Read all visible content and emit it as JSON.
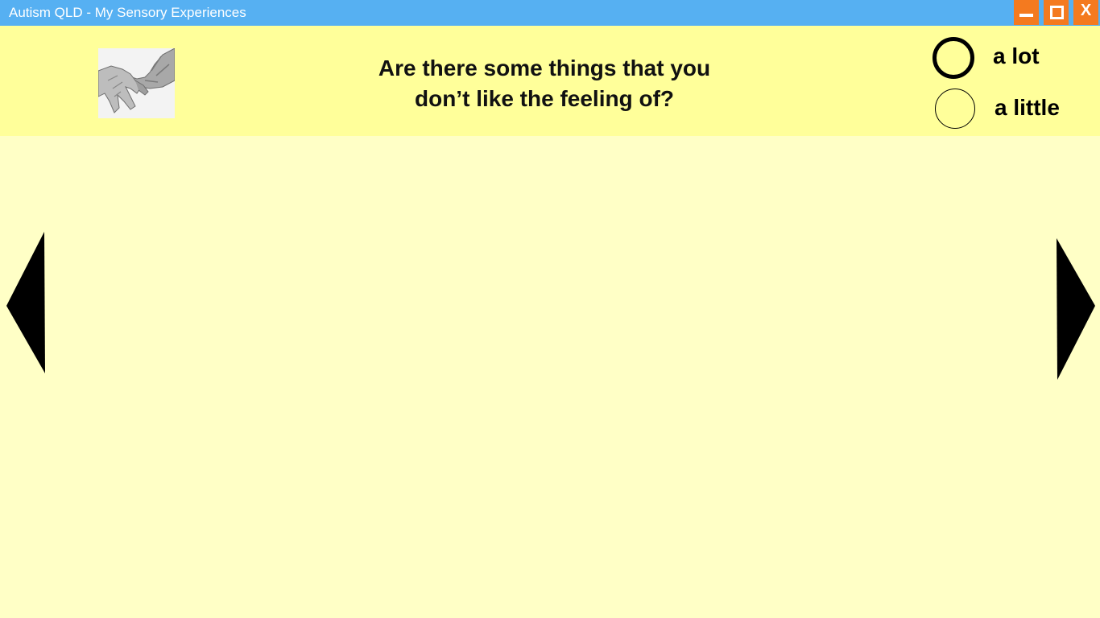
{
  "window": {
    "title": "Autism QLD - My Sensory Experiences",
    "controls": {
      "close_label": "X"
    },
    "titlebar_color": "#56b0f2",
    "button_color": "#f47a1f"
  },
  "header": {
    "background_color": "#ffff9a",
    "question_line1": "Are there some things that you",
    "question_line2": "don’t like the feeling of?",
    "image_icon": "hands-touching-image"
  },
  "options": [
    {
      "label": "a lot",
      "selected": true
    },
    {
      "label": "a little",
      "selected": false
    }
  ],
  "navigation": {
    "previous_icon": "left-triangle-arrow",
    "next_icon": "right-triangle-arrow"
  },
  "content": {
    "background_color": "#ffffc6"
  }
}
